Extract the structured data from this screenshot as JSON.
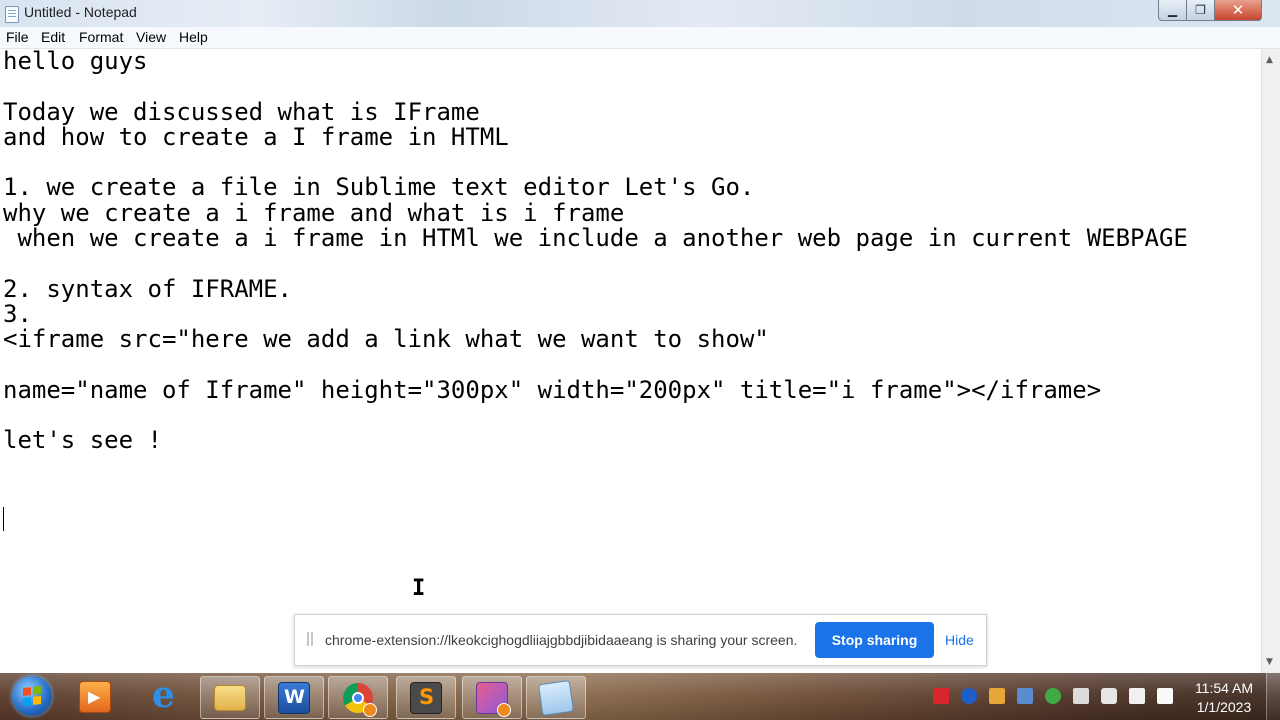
{
  "window": {
    "title": "Untitled - Notepad",
    "minimize_glyph": "▁",
    "maximize_glyph": "❐",
    "close_glyph": "✕"
  },
  "menu": {
    "items": [
      "File",
      "Edit",
      "Format",
      "View",
      "Help"
    ]
  },
  "editor": {
    "text": "hello guys\n\nToday we discussed what is IFrame\nand how to create a I frame in HTML\n\n1. we create a file in Sublime text editor Let's Go.\nwhy we create a i frame and what is i frame\n when we create a i frame in HTMl we include a another web page in current WEBPAGE\n\n2. syntax of IFRAME.\n3.\n<iframe src=\"here we add a link what we want to show\"\n\nname=\"name of Iframe\" height=\"300px\" width=\"200px\" title=\"i frame\"></iframe>\n\nlet's see !",
    "cursor_glyph": "I"
  },
  "share_bar": {
    "message": "chrome-extension://lkeokcighogdliiajgbbdjibidaaeang is sharing your screen.",
    "stop_label": "Stop sharing",
    "hide_label": "Hide",
    "accent_color": "#1a73e8"
  },
  "taskbar": {
    "pinned": [
      {
        "name": "windows-media-player",
        "icon": "media-player-icon"
      },
      {
        "name": "internet-explorer",
        "icon": "internet-explorer-icon"
      },
      {
        "name": "windows-explorer",
        "icon": "folder-icon"
      },
      {
        "name": "microsoft-word",
        "icon": "word-icon"
      },
      {
        "name": "google-chrome",
        "icon": "chrome-icon"
      },
      {
        "name": "sublime-text",
        "icon": "sublime-text-icon"
      },
      {
        "name": "paint",
        "icon": "paint-icon"
      },
      {
        "name": "notepad",
        "icon": "notepad-icon"
      }
    ],
    "tray_icons": [
      "record-icon",
      "bluetooth-icon",
      "folder-icon",
      "display-icon",
      "sync-icon",
      "removable-device-icon",
      "volume-icon",
      "network-signal-icon",
      "action-center-flag-icon"
    ],
    "clock_time": "11:54 AM",
    "clock_date": "1/1/2023"
  }
}
